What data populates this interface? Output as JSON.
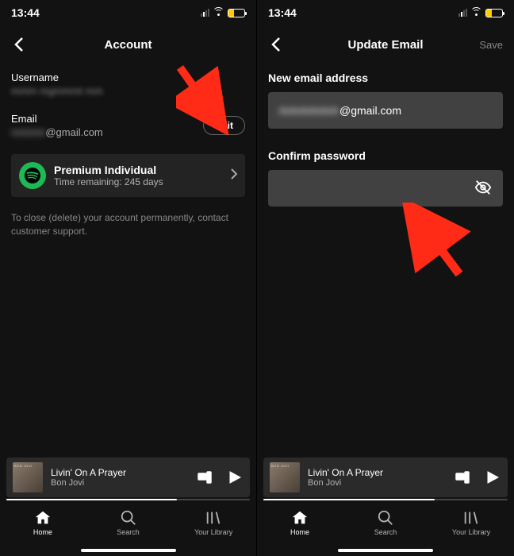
{
  "status": {
    "time": "13:44"
  },
  "left": {
    "title": "Account",
    "username_label": "Username",
    "email_label": "Email",
    "email_suffix": "@gmail.com",
    "edit_label": "Edit",
    "plan_title": "Premium Individual",
    "plan_sub": "Time remaining: 245 days",
    "close_note": "To close (delete) your account permanently, contact customer support."
  },
  "right": {
    "title": "Update Email",
    "save_label": "Save",
    "new_email_label": "New email address",
    "new_email_suffix": "@gmail.com",
    "confirm_pw_label": "Confirm password"
  },
  "now_playing": {
    "title": "Livin' On A Prayer",
    "artist": "Bon Jovi"
  },
  "tabs": {
    "home": "Home",
    "search": "Search",
    "library": "Your Library"
  }
}
